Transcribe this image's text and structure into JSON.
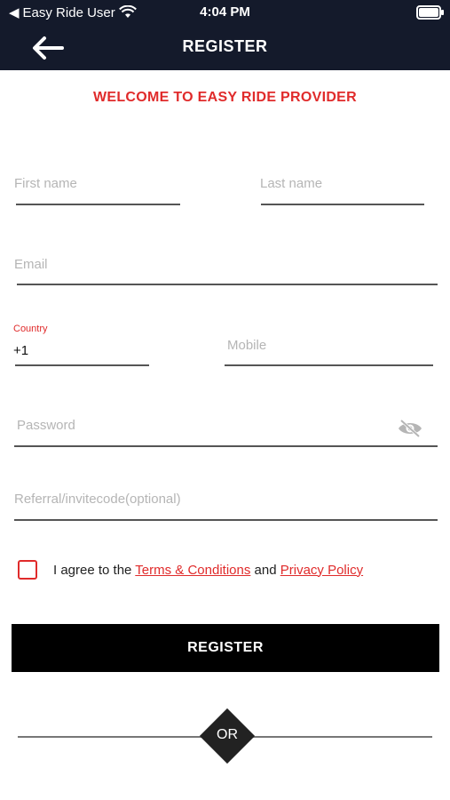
{
  "status": {
    "carrier": "Easy Ride User",
    "time": "4:04 PM",
    "back_indicator": "◀"
  },
  "header": {
    "title": "REGISTER"
  },
  "welcome": "WELCOME TO EASY RIDE PROVIDER",
  "form": {
    "first_name": {
      "placeholder": "First name"
    },
    "last_name": {
      "placeholder": "Last name"
    },
    "email": {
      "placeholder": "Email"
    },
    "country": {
      "label": "Country",
      "value": "+1"
    },
    "mobile": {
      "placeholder": "Mobile"
    },
    "password": {
      "placeholder": "Password"
    },
    "referral": {
      "placeholder": "Referral/invitecode(optional)"
    }
  },
  "agreement": {
    "prefix": "I agree to the ",
    "terms": "Terms & Conditions",
    "middle": " and ",
    "privacy": "Privacy Policy"
  },
  "register_button": "REGISTER",
  "separator": "OR",
  "colors": {
    "header_bg": "#141a2b",
    "accent_red": "#e02b2b",
    "button_bg": "#000000"
  },
  "icons": [
    "back-arrow-icon",
    "wifi-icon",
    "battery-icon",
    "eye-off-icon"
  ]
}
